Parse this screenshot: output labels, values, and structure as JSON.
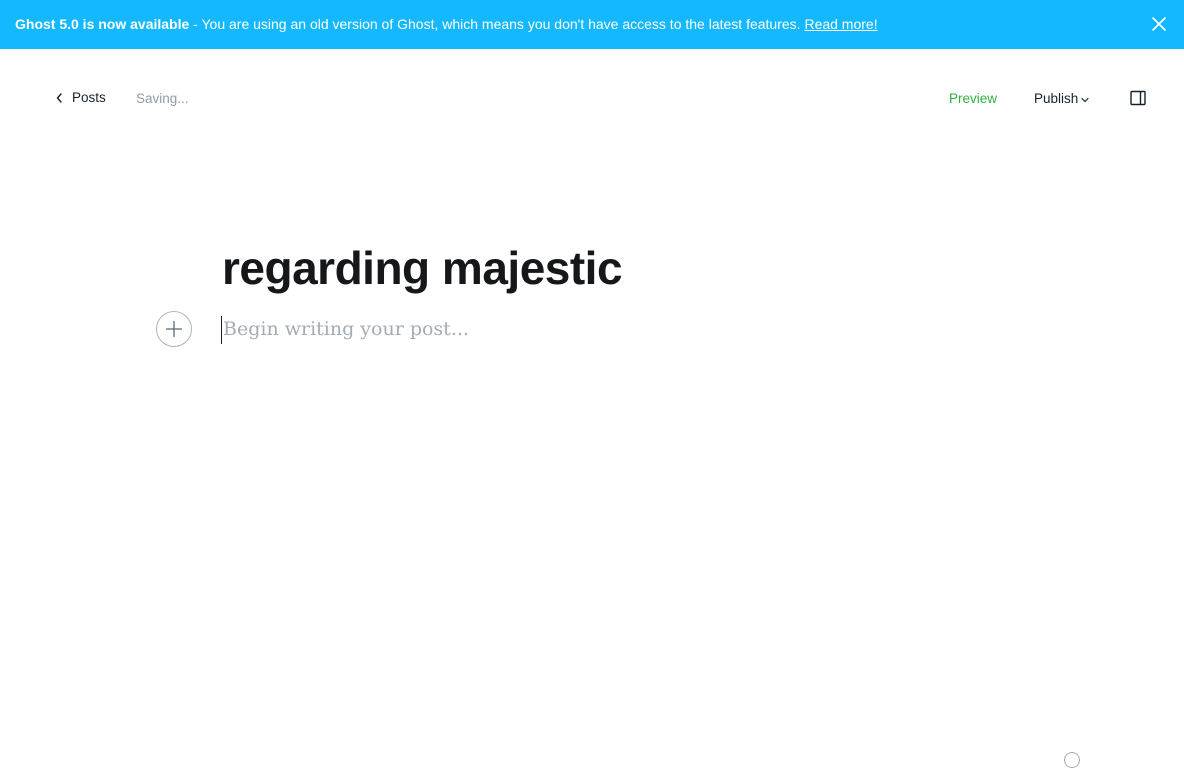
{
  "banner": {
    "strong": "Ghost 5.0 is now available",
    "message": " - You are using an old version of Ghost, which means you don't have access to the latest features. ",
    "link": "Read more!",
    "close_icon": "close-icon",
    "color": "#14b8ff"
  },
  "header": {
    "back_label": "Posts",
    "back_icon": "chevron-left-icon",
    "status": "Saving...",
    "preview_label": "Preview",
    "publish_label": "Publish",
    "publish_icon": "chevron-down-icon",
    "settings_icon": "sidebar-toggle-icon",
    "preview_color": "#2fb344"
  },
  "editor": {
    "title": "regarding majestic",
    "body_placeholder": "Begin writing your post...",
    "add_card_icon": "plus-icon"
  },
  "footer": {
    "help_icon": "help-icon"
  }
}
